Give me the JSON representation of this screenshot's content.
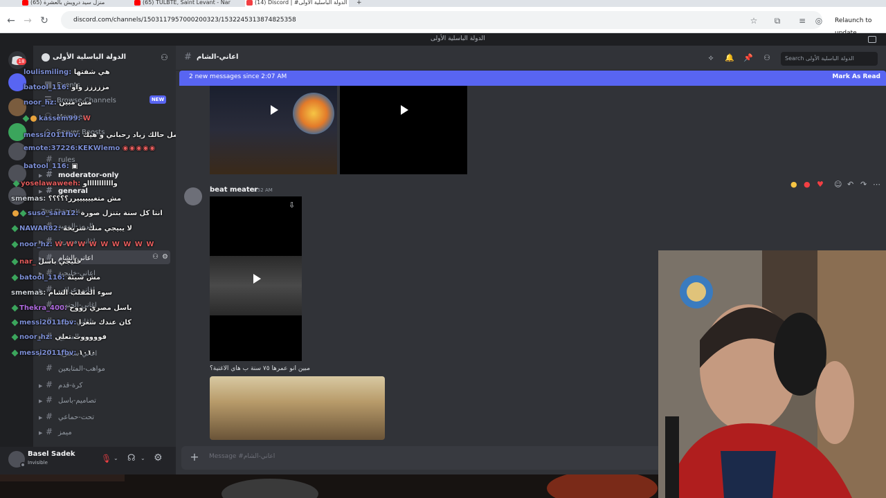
{
  "browser": {
    "tabs": [
      {
        "label": "(65) منزل سيد درويش بالعشرة",
        "favicon_color": "#ff0000",
        "active": false
      },
      {
        "label": "(65) TULBTE, Saint Levant - Nar",
        "favicon_color": "#ff0000",
        "active": false
      },
      {
        "label": "(14) Discord | #اعاني الشام | الدولة الباسلية الأولى",
        "favicon_color": "#f23f43",
        "active": true
      }
    ],
    "url": "discord.com/channels/1503117957000200323/1532245313874825358",
    "relaunch_label": "Relaunch to update"
  },
  "window_title": "الدولة الباسلية الأولى",
  "server_rail": {
    "unread_badge": "18",
    "dm_badge": "1"
  },
  "guild": {
    "name": "الدولة الباسلية الأولى",
    "items": [
      {
        "label": "Events"
      },
      {
        "label": "Browse Channels",
        "tag": "NEW"
      },
      {
        "label": "Members"
      },
      {
        "label": "Server Boosts"
      }
    ],
    "channels": [
      {
        "label": "rules",
        "style": "dim"
      },
      {
        "label": "moderator-only",
        "style": "bright"
      },
      {
        "label": "general",
        "style": "bright"
      },
      {
        "label": "Text Channels",
        "style": "category"
      },
      {
        "label": "الرمز-المعبد",
        "style": "normal"
      },
      {
        "label": "اغاني-مصرية",
        "style": "normal"
      },
      {
        "label": "اعاني-الشام",
        "style": "selected"
      },
      {
        "label": "اعاني-خليجية",
        "style": "normal"
      },
      {
        "label": "اغاني-عراقي",
        "style": "normal"
      },
      {
        "label": "اغاني-الجنوب",
        "style": "dim"
      },
      {
        "label": "اغاني-عربية",
        "style": "dim"
      },
      {
        "label": "بيت-المسيح",
        "style": "normal"
      },
      {
        "label": "اغاني-ساهرية",
        "style": "normal"
      },
      {
        "label": "مواهب-المتابعين",
        "style": "dim"
      },
      {
        "label": "كرة-قدم",
        "style": "normal"
      },
      {
        "label": "تصاميم-باسل",
        "style": "normal"
      },
      {
        "label": "تحت-حماعي",
        "style": "normal"
      },
      {
        "label": "ميمز",
        "style": "normal"
      }
    ]
  },
  "chat_overlay": [
    {
      "user": "loulismiling:",
      "message": "هي شفتها"
    },
    {
      "user": "batool_116:",
      "message": "مززززز واو"
    },
    {
      "user": "noor_hz:",
      "message": "مش مبين"
    },
    {
      "user": "kassem99:",
      "message": ""
    },
    {
      "user": "messi2011fbv:",
      "message": "عامل حالك زياد رحباني و هيك"
    },
    {
      "user": "emote:37226:KEKWlemo",
      "message": ""
    },
    {
      "user": "batool_116:",
      "message": ""
    },
    {
      "user": "yoselawaweeh:",
      "message": "واااااااااااو"
    },
    {
      "user": "smemas:",
      "message": "مش متغييييييرر؟؟؟؟؟"
    },
    {
      "user": "suso_sara12:",
      "message": "انتا كل سنة بتنزل صورة"
    },
    {
      "user": "NAWAR82:",
      "message": "لا يبيجي منك شريحة"
    },
    {
      "user": "noor_hz:",
      "message": ""
    },
    {
      "user": "nar_",
      "message": "خليجي باسل"
    },
    {
      "user": "batool_116:",
      "message": "مش سيئة"
    },
    {
      "user": "smemas:",
      "message": "سوء المقلب الشام"
    },
    {
      "user": "Thekra_400:",
      "message": "باسل مصري رووح"
    },
    {
      "user": "messi2011fbv:",
      "message": "كان عندك شعرا"
    },
    {
      "user": "noor_hz:",
      "message": "فوووووت تعلي"
    },
    {
      "user": "messi2011fbv:",
      "message": "١٠١٠"
    }
  ],
  "user_panel": {
    "name": "Basel Sadek",
    "status": "Invisible"
  },
  "channel_header": {
    "name": "اعاني-الشام",
    "search_placeholder": "Search الدولة الباسلية الأولى"
  },
  "new_messages_bar": {
    "text": "2 new messages since 2:07 AM",
    "action": "Mark As Read"
  },
  "messages": [
    {
      "author": "beat meater",
      "time": "1:52 AM",
      "attachment_type": "video"
    },
    {
      "author": "",
      "time": "",
      "text": "مبين انو عمرها ٧٥ سنة ب هاي الاغنية؟"
    }
  ],
  "composer": {
    "placeholder": "Message #اعاني-الشام"
  },
  "colors": {
    "accent": "#5865f2",
    "rail_bg": "#1e1f22",
    "sidebar_bg": "#2b2d31",
    "main_bg": "#313338",
    "mention_red": "#f23f43"
  }
}
